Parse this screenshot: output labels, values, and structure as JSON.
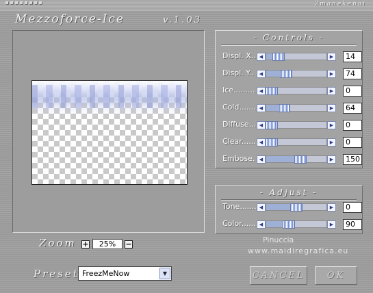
{
  "header": {
    "credit": "2manekenai",
    "title": "Mezzoforce-Ice",
    "version": "v.1.03"
  },
  "controls": {
    "title": "Controls",
    "rows": [
      {
        "label": "Displ. X..",
        "value": "14",
        "level": 0.14
      },
      {
        "label": "Displ. Y..",
        "value": "74",
        "level": 0.29
      },
      {
        "label": "Ice.........",
        "value": "0",
        "level": 0.0
      },
      {
        "label": "Cold........",
        "value": "64",
        "level": 0.25
      },
      {
        "label": "Diffuse.....",
        "value": "0",
        "level": 0.0
      },
      {
        "label": "Clear.......",
        "value": "0",
        "level": 0.0
      },
      {
        "label": "Embose.",
        "value": "150",
        "level": 0.59
      }
    ]
  },
  "adjust": {
    "title": "Adjust",
    "rows": [
      {
        "label": "Tone.......",
        "value": "0",
        "level": 0.5
      },
      {
        "label": "Color.......",
        "value": "90",
        "level": 0.35
      }
    ]
  },
  "zoom": {
    "label": "Zoom",
    "plus": "+",
    "minus": "−",
    "value": "25%"
  },
  "preset": {
    "label": "Preset",
    "value": "FreezMeNow"
  },
  "watermark": {
    "line1": "Pinuccia",
    "line2": "www.maidiregrafica.eu"
  },
  "buttons": {
    "cancel": "CANCEL",
    "ok": "OK"
  },
  "colors": {
    "background": "#9a9a9a",
    "slider_thumb": "#6f8cd2",
    "ice_tint": "#aab6e4"
  }
}
